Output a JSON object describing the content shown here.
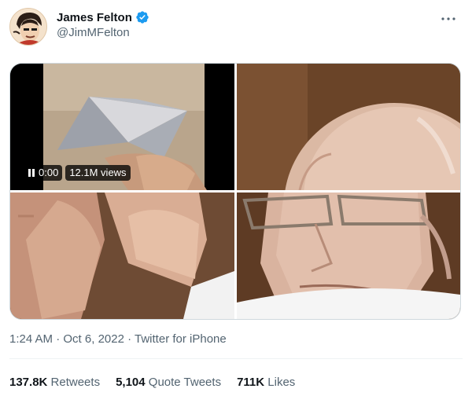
{
  "author": {
    "name": "James Felton",
    "handle": "@JimMFelton",
    "verified": true
  },
  "video": {
    "time": "0:00",
    "views": "12.1M views"
  },
  "timestamp": {
    "time": "1:24 AM",
    "separator1": " · ",
    "date": "Oct 6, 2022",
    "separator2": " · ",
    "source": "Twitter for iPhone"
  },
  "stats": {
    "retweets_count": "137.8K",
    "retweets_label": " Retweets",
    "quotes_count": "5,104",
    "quotes_label": " Quote Tweets",
    "likes_count": "711K",
    "likes_label": " Likes"
  },
  "colors": {
    "verified_blue": "#1d9bf0",
    "secondary_text": "#536471",
    "primary_text": "#0f1419"
  },
  "icons": {
    "verified": "verified-badge-icon",
    "more": "more-options-icon",
    "pause": "pause-icon"
  }
}
